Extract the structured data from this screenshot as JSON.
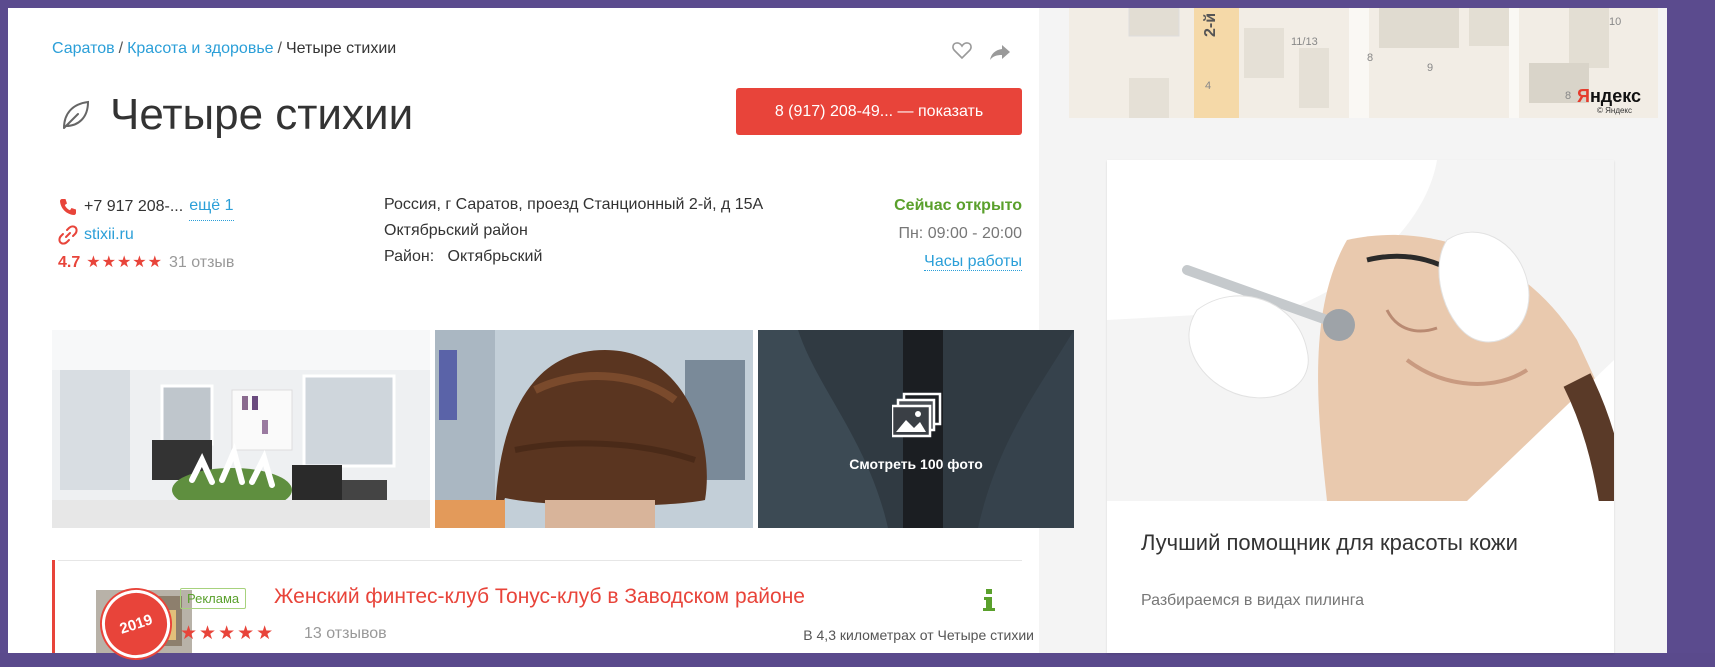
{
  "breadcrumb": {
    "items": [
      "Саратов",
      "Красота и здоровье"
    ],
    "separator": "/",
    "current": "Четыре стихии"
  },
  "company": {
    "name": "Четыре стихии",
    "phone_button": "8 (917) 208-49... — показать",
    "phone_short": "+7 917 208-...",
    "phone_more": "ещё 1",
    "website": "stixii.ru",
    "rating": "4.7",
    "stars": "★★★★★",
    "reviews": "31 отзыв"
  },
  "address": {
    "line1": "Россия, г Саратов, проезд Станционный 2-й, д 15А",
    "district": "Октябрьский район",
    "area_label": "Район:",
    "area_value": "Октябрьский"
  },
  "hours": {
    "status": "Сейчас открыто",
    "today": "Пн: 09:00 - 20:00",
    "link": "Часы работы"
  },
  "photos": {
    "more_label": "Смотреть 100 фото"
  },
  "ad": {
    "tag": "Реклама",
    "title": "Женский финтес-клуб Тонус-клуб в Заводском районе",
    "stars": "★★★★★",
    "reviews": "13 отзывов",
    "distance": "В 4,3 километрах от Четыре стихии",
    "badge_year": "2019"
  },
  "map": {
    "brand": "Яндекс",
    "copyright": "© Яндекс",
    "street": "2-й",
    "numbers": [
      "11/13",
      "8",
      "9",
      "4",
      "10",
      "8"
    ]
  },
  "article": {
    "title": "Лучший помощник для красоты кожи",
    "subtitle": "Разбираемся в видах пилинга"
  },
  "colors": {
    "accent_red": "#e8443a",
    "link_blue": "#2b9fd8",
    "open_green": "#5aa02c",
    "frame_purple": "#5b4b8e"
  }
}
